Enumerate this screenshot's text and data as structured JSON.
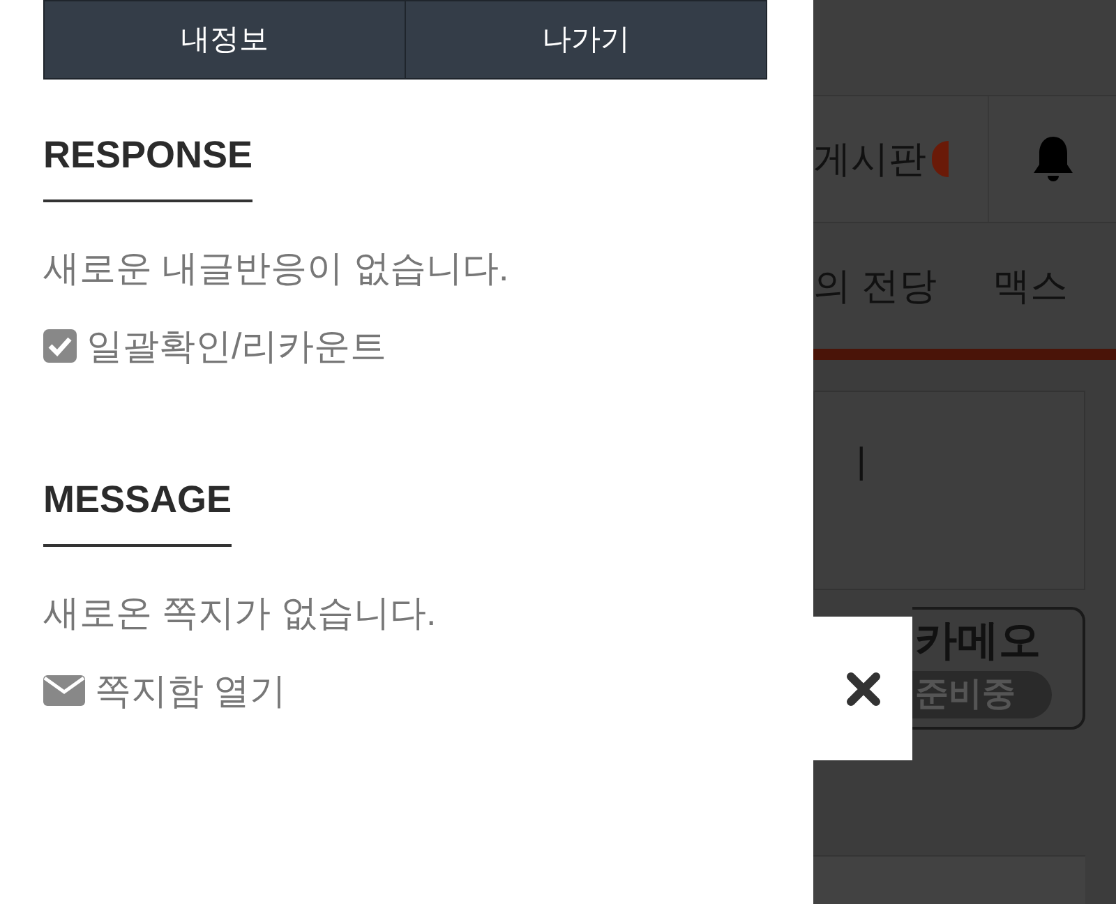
{
  "drawer": {
    "buttons": [
      {
        "label": "내정보"
      },
      {
        "label": "나가기"
      }
    ],
    "sections": [
      {
        "heading": "RESPONSE",
        "empty_text": "새로운 내글반응이 없습니다.",
        "action": {
          "kind": "checkbox",
          "label": "일괄확인/리카운트",
          "checked": true
        }
      },
      {
        "heading": "MESSAGE",
        "empty_text": "새로온 쪽지가 없습니다.",
        "action": {
          "kind": "mail",
          "label": "쪽지함 열기"
        }
      }
    ]
  },
  "background_page": {
    "header_tab": "게시판",
    "nav_items": [
      "의 전당",
      "맥스"
    ],
    "box_text": "|",
    "banner": {
      "title": "카메오",
      "badge": "준비중"
    }
  }
}
